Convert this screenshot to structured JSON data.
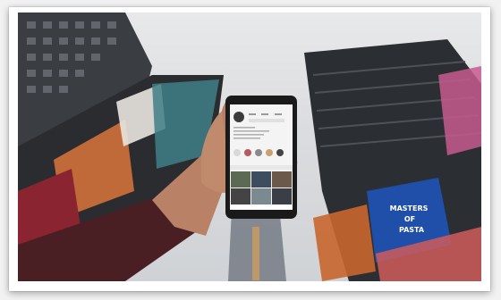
{
  "photo": {
    "description_icon": "photo-image",
    "colors": {
      "sky": "#dcdddf",
      "building_dark": "#2b2e33",
      "billboard_blue": "#1f4fa8",
      "phone_body": "#1a1a1a",
      "phone_screen": "#f4f4f4",
      "skin": "#b98266",
      "sleeve": "#4a1f24"
    }
  },
  "billboard": {
    "line1": "MASTERS",
    "line2": "OF",
    "line3": "PASTA"
  }
}
